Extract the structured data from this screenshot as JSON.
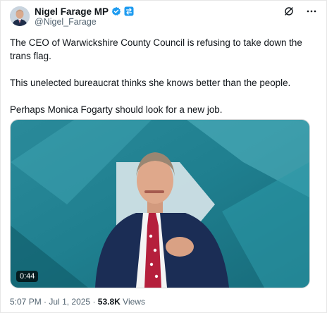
{
  "author": {
    "display_name": "Nigel Farage MP",
    "handle": "@Nigel_Farage"
  },
  "icons": {
    "verified": "verified-badge-icon",
    "affiliate": "affiliate-badge-icon",
    "grok": "grok-icon",
    "more": "more-icon"
  },
  "colors": {
    "verified_blue": "#1d9bf0",
    "meta_grey": "#536471",
    "text": "#0f1419",
    "video_teal": "#1a7d8c"
  },
  "tweet": {
    "paragraphs": [
      "The CEO of Warwickshire County Council is refusing to take down the trans flag.",
      "This unelected bureaucrat thinks she knows better than the people.",
      "Perhaps Monica Fogarty should look for a new job."
    ]
  },
  "media": {
    "duration": "0:44"
  },
  "meta": {
    "time": "5:07 PM",
    "separator": "·",
    "date": "Jul 1, 2025",
    "views_count": "53.8K",
    "views_label": "Views"
  }
}
